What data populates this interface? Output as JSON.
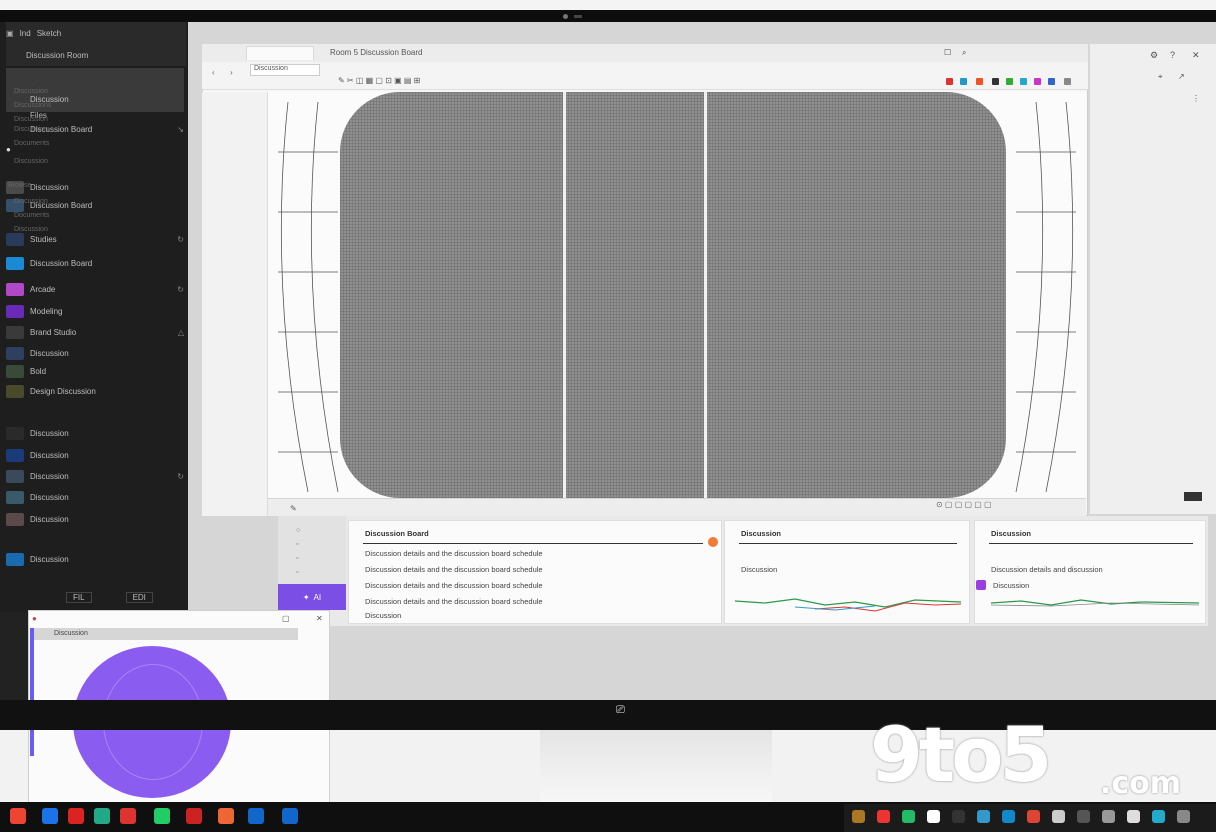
{
  "sidebar": {
    "header": [
      "Ind",
      "Sketch",
      "Discussion Room"
    ],
    "selected": [
      "Discussion",
      "Files",
      "Discussion Board"
    ],
    "items": [
      {
        "label": "Discussion",
        "thumb": "#4a4a4a"
      },
      {
        "label": "Discussion Board",
        "thumb": "#34506a"
      },
      {
        "label": "Studies",
        "thumb": "#2a3a5a"
      },
      {
        "label": "Discussion Board",
        "thumb": "#1b8ad6"
      },
      {
        "label": "Arcade",
        "thumb": "#b048c8"
      },
      {
        "label": "Modeling",
        "thumb": "#6a2ab8"
      },
      {
        "label": "Brand Studio",
        "thumb": "#3a3a3a"
      },
      {
        "label": "Discussion",
        "thumb": "#2f3f5f"
      },
      {
        "label": "Bold",
        "thumb": "#3a4a3a"
      },
      {
        "label": "Design Discussion",
        "thumb": "#4a4a2a"
      },
      {
        "label": "Discussion",
        "thumb": "#2a2a2a"
      },
      {
        "label": "Discussion",
        "thumb": "#1a3a7a"
      },
      {
        "label": "Discussion",
        "thumb": "#3a4a5a"
      },
      {
        "label": "Discussion",
        "thumb": "#3a5a6a"
      },
      {
        "label": "Discussion",
        "thumb": "#5a4a4a"
      },
      {
        "label": "Discussion",
        "thumb": "#1a6ab0"
      }
    ],
    "footer": [
      "FIL",
      "EDI"
    ]
  },
  "app": {
    "tab_label": "",
    "title": "Room 5 Discussion Board",
    "path": "Discussion",
    "nav_items": [
      "Discussion",
      "Discussions",
      "Discussion",
      "Discussion",
      "Documents",
      "Discussion",
      "Browse",
      "Discussion",
      "Documents",
      "Discussion"
    ],
    "tool_colors": [
      "#d33",
      "#e52",
      "#3a3",
      "#29c",
      "#c3c",
      "#333",
      "#36c"
    ],
    "purple_label": "AI"
  },
  "cards": [
    {
      "title": "Discussion Board",
      "lines": [
        "Discussion details and the discussion board schedule",
        "Discussion details and the discussion board schedule",
        "Discussion details and the discussion board schedule",
        "Discussion details and the discussion board schedule",
        "Discussion"
      ]
    },
    {
      "title": "Discussion",
      "lines": [
        "Discussion"
      ]
    },
    {
      "title": "Discussion",
      "lines": [
        "Discussion details and discussion",
        "Discussion"
      ]
    }
  ],
  "mini": {
    "bar_label": "Discussion"
  },
  "watermark": {
    "main": "9to5",
    "suffix": ".com"
  },
  "taskbar": {
    "colors": [
      "#e43",
      "#1a73e8",
      "#d22",
      "#2a8",
      "#d33",
      "#2c6",
      "#c22",
      "#e63",
      "#16c",
      "#16c"
    ]
  },
  "tray": {
    "colors": [
      "#a72",
      "#e33",
      "#2b6",
      "#fff",
      "#333",
      "#39c",
      "#18c",
      "#d43",
      "#ccc",
      "#555",
      "#999",
      "#ddd",
      "#2ac",
      "#888"
    ]
  }
}
